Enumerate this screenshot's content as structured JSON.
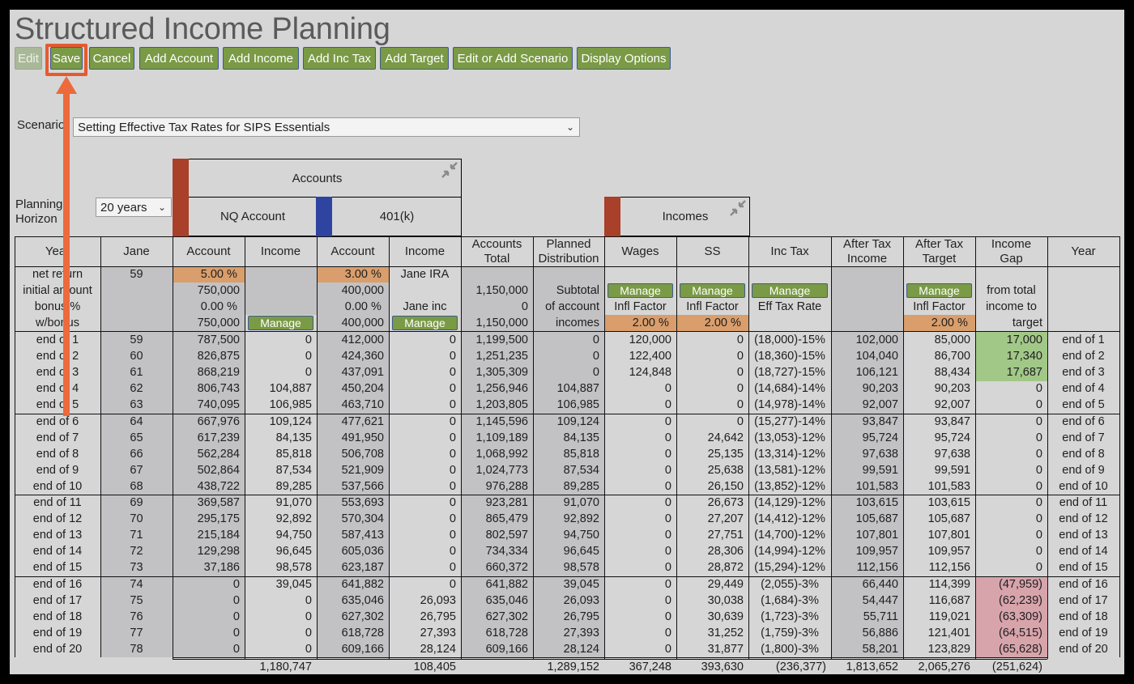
{
  "app": {
    "title": "Structured Income Planning"
  },
  "toolbar": {
    "edit": "Edit",
    "save": "Save",
    "cancel": "Cancel",
    "add_account": "Add Account",
    "add_income": "Add Income",
    "add_inc_tax": "Add Inc Tax",
    "add_target": "Add Target",
    "edit_scenario": "Edit or Add Scenario",
    "display_options": "Display Options"
  },
  "scenario": {
    "label": "Scenario",
    "value": "Setting Effective Tax Rates for SIPS Essentials"
  },
  "horizon": {
    "label_line1": "Planning",
    "label_line2": "Horizon",
    "value": "20 years"
  },
  "groups": {
    "accounts": "Accounts",
    "nq_account": "NQ Account",
    "k401": "401(k)",
    "incomes": "Incomes"
  },
  "colors": {
    "accent_green": "#7a9a46",
    "nq_swatch": "#a8402a",
    "k401_swatch": "#2f44a0",
    "incomes_swatch": "#a8402a",
    "highlight": "#e55b2e"
  },
  "columns": {
    "year": "Year",
    "jane": "Jane",
    "account": "Account",
    "income": "Income",
    "accounts_total_1": "Accounts",
    "accounts_total_2": "Total",
    "planned_1": "Planned",
    "planned_2": "Distribution",
    "wages": "Wages",
    "ss": "SS",
    "inc_tax": "Inc Tax",
    "after_tax_income_1": "After Tax",
    "after_tax_income_2": "Income",
    "after_tax_target_1": "After Tax",
    "after_tax_target_2": "Target",
    "income_gap_1": "Income",
    "income_gap_2": "Gap",
    "year_right": "Year"
  },
  "params": {
    "row_labels": [
      "net return",
      "initial amount",
      "bonus %",
      "w/bonus"
    ],
    "jane_age": "59",
    "nq_rate": "5.00",
    "nq_initial": "750,000",
    "nq_bonus": "0.00",
    "nq_wbonus": "750,000",
    "k401_rate": "3.00",
    "k401_initial": "400,000",
    "k401_bonus": "0.00",
    "k401_wbonus": "400,000",
    "k401_income_1": "Jane IRA",
    "k401_income_3": "Jane inc",
    "total_initial": "1,150,000",
    "total_bonus": "0",
    "total_wbonus": "1,150,000",
    "planned_1": "Subtotal",
    "planned_2": "of account",
    "planned_3": "incomes",
    "manage": "Manage",
    "infl_factor": "Infl Factor",
    "wages_infl": "2.00",
    "ss_infl": "2.00",
    "eff_tax_rate": "Eff Tax Rate",
    "target_infl": "2.00",
    "gap_1": "from total",
    "gap_2": "income to",
    "gap_3": "target",
    "pct": "%"
  },
  "rows": [
    [
      "end of 1",
      "59",
      "787,500",
      "0",
      "412,000",
      "0",
      "1,199,500",
      "0",
      "120,000",
      "0",
      "(18,000)-15%",
      "102,000",
      "85,000",
      "17,000",
      "end of 1"
    ],
    [
      "end of 2",
      "60",
      "826,875",
      "0",
      "424,360",
      "0",
      "1,251,235",
      "0",
      "122,400",
      "0",
      "(18,360)-15%",
      "104,040",
      "86,700",
      "17,340",
      "end of 2"
    ],
    [
      "end of 3",
      "61",
      "868,219",
      "0",
      "437,091",
      "0",
      "1,305,309",
      "0",
      "124,848",
      "0",
      "(18,727)-15%",
      "106,121",
      "88,434",
      "17,687",
      "end of 3"
    ],
    [
      "end of 4",
      "62",
      "806,743",
      "104,887",
      "450,204",
      "0",
      "1,256,946",
      "104,887",
      "0",
      "0",
      "(14,684)-14%",
      "90,203",
      "90,203",
      "0",
      "end of 4"
    ],
    [
      "end of 5",
      "63",
      "740,095",
      "106,985",
      "463,710",
      "0",
      "1,203,805",
      "106,985",
      "0",
      "0",
      "(14,978)-14%",
      "92,007",
      "92,007",
      "0",
      "end of 5"
    ],
    [
      "end of 6",
      "64",
      "667,976",
      "109,124",
      "477,621",
      "0",
      "1,145,596",
      "109,124",
      "0",
      "0",
      "(15,277)-14%",
      "93,847",
      "93,847",
      "0",
      "end of 6"
    ],
    [
      "end of 7",
      "65",
      "617,239",
      "84,135",
      "491,950",
      "0",
      "1,109,189",
      "84,135",
      "0",
      "24,642",
      "(13,053)-12%",
      "95,724",
      "95,724",
      "0",
      "end of 7"
    ],
    [
      "end of 8",
      "66",
      "562,284",
      "85,818",
      "506,708",
      "0",
      "1,068,992",
      "85,818",
      "0",
      "25,135",
      "(13,314)-12%",
      "97,638",
      "97,638",
      "0",
      "end of 8"
    ],
    [
      "end of 9",
      "67",
      "502,864",
      "87,534",
      "521,909",
      "0",
      "1,024,773",
      "87,534",
      "0",
      "25,638",
      "(13,581)-12%",
      "99,591",
      "99,591",
      "0",
      "end of 9"
    ],
    [
      "end of 10",
      "68",
      "438,722",
      "89,285",
      "537,566",
      "0",
      "976,288",
      "89,285",
      "0",
      "26,150",
      "(13,852)-12%",
      "101,583",
      "101,583",
      "0",
      "end of 10"
    ],
    [
      "end of 11",
      "69",
      "369,587",
      "91,070",
      "553,693",
      "0",
      "923,281",
      "91,070",
      "0",
      "26,673",
      "(14,129)-12%",
      "103,615",
      "103,615",
      "0",
      "end of 11"
    ],
    [
      "end of 12",
      "70",
      "295,175",
      "92,892",
      "570,304",
      "0",
      "865,479",
      "92,892",
      "0",
      "27,207",
      "(14,412)-12%",
      "105,687",
      "105,687",
      "0",
      "end of 12"
    ],
    [
      "end of 13",
      "71",
      "215,184",
      "94,750",
      "587,413",
      "0",
      "802,597",
      "94,750",
      "0",
      "27,751",
      "(14,700)-12%",
      "107,801",
      "107,801",
      "0",
      "end of 13"
    ],
    [
      "end of 14",
      "72",
      "129,298",
      "96,645",
      "605,036",
      "0",
      "734,334",
      "96,645",
      "0",
      "28,306",
      "(14,994)-12%",
      "109,957",
      "109,957",
      "0",
      "end of 14"
    ],
    [
      "end of 15",
      "73",
      "37,186",
      "98,578",
      "623,187",
      "0",
      "660,372",
      "98,578",
      "0",
      "28,872",
      "(15,294)-12%",
      "112,156",
      "112,156",
      "0",
      "end of 15"
    ],
    [
      "end of 16",
      "74",
      "0",
      "39,045",
      "641,882",
      "0",
      "641,882",
      "39,045",
      "0",
      "29,449",
      "(2,055)-3%",
      "66,440",
      "114,399",
      "(47,959)",
      "end of 16"
    ],
    [
      "end of 17",
      "75",
      "0",
      "0",
      "635,046",
      "26,093",
      "635,046",
      "26,093",
      "0",
      "30,038",
      "(1,684)-3%",
      "54,447",
      "116,687",
      "(62,239)",
      "end of 17"
    ],
    [
      "end of 18",
      "76",
      "0",
      "0",
      "627,302",
      "26,795",
      "627,302",
      "26,795",
      "0",
      "30,639",
      "(1,723)-3%",
      "55,711",
      "119,021",
      "(63,309)",
      "end of 18"
    ],
    [
      "end of 19",
      "77",
      "0",
      "0",
      "618,728",
      "27,393",
      "618,728",
      "27,393",
      "0",
      "31,252",
      "(1,759)-3%",
      "56,886",
      "121,401",
      "(64,515)",
      "end of 19"
    ],
    [
      "end of 20",
      "78",
      "0",
      "0",
      "609,166",
      "28,124",
      "609,166",
      "28,124",
      "0",
      "31,877",
      "(1,800)-3%",
      "58,201",
      "123,829",
      "(65,628)",
      "end of 20"
    ]
  ],
  "totals": [
    "",
    "",
    "",
    "1,180,747",
    "",
    "108,405",
    "",
    "1,289,152",
    "367,248",
    "393,630",
    "(236,377)",
    "1,813,652",
    "2,065,276",
    "(251,624)",
    ""
  ]
}
